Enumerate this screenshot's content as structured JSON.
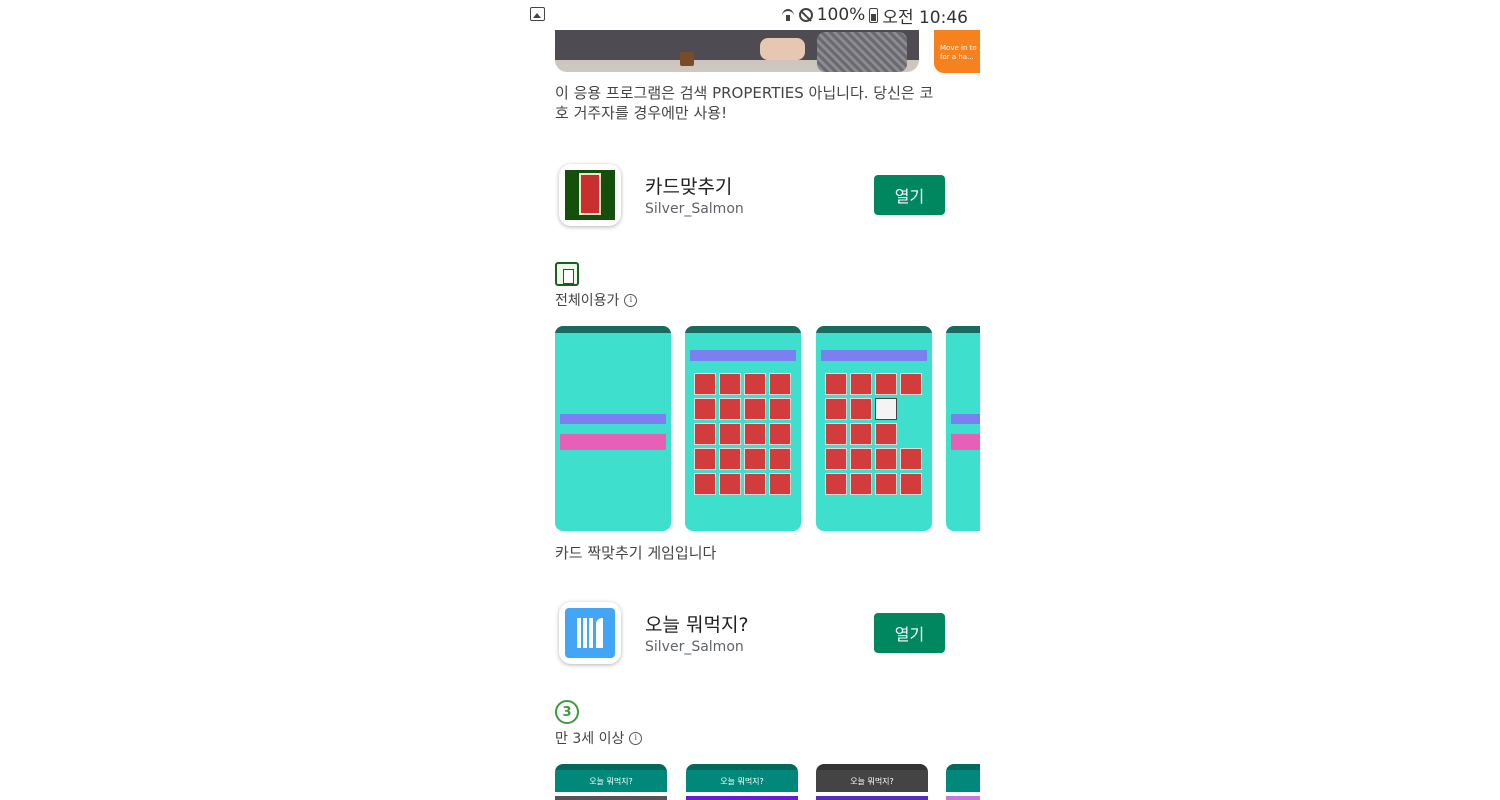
{
  "status_bar": {
    "battery": "100%",
    "time": "오전 10:46"
  },
  "banner": {
    "side_text": "Move in to ... for a ha..."
  },
  "description_top": "이 응용 프로그램은 검색 PROPERTIES 아닙니다. 당신은 코호 거주자를 경우에만 사용!",
  "apps": [
    {
      "title": "카드맞추기",
      "developer": "Silver_Salmon",
      "button": "열기",
      "rating": "전체이용가",
      "description": "카드 짝맞추기 게임입니다"
    },
    {
      "title": "오늘 뭐먹지?",
      "developer": "Silver_Salmon",
      "button": "열기",
      "rating_badge": "3",
      "rating": "만 3세 이상",
      "screenshot_title": "오늘 뭐먹지?"
    }
  ],
  "info_glyph": "i",
  "icons": [
    "gallery-icon",
    "wifi-icon",
    "dnd-icon",
    "battery-icon",
    "info-icon",
    "utensils-icon",
    "card-icon"
  ],
  "colors": {
    "open_button": "#01875f",
    "screenshot_bg": "#3ee0cd",
    "card": "#d23c3c"
  }
}
